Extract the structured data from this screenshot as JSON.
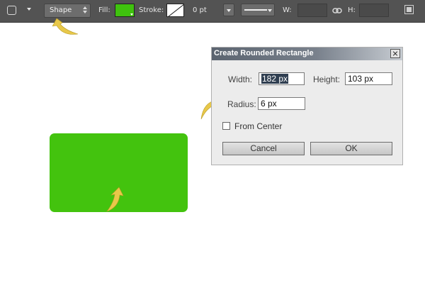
{
  "toolbar": {
    "mode_value": "Shape",
    "fill_label": "Fill:",
    "fill_color": "#3fc20e",
    "stroke_label": "Stroke:",
    "stroke_width": "0 pt",
    "w_label": "W:",
    "h_label": "H:"
  },
  "canvas": {
    "shape_color": "#43c30e",
    "callout_color": "#e8c84a"
  },
  "dialog": {
    "title": "Create Rounded Rectangle",
    "width_label": "Width:",
    "width_value": "182 px",
    "height_label": "Height:",
    "height_value": "103 px",
    "radius_label": "Radius:",
    "radius_value": "6 px",
    "from_center_label": "From Center",
    "from_center_checked": false,
    "cancel_label": "Cancel",
    "ok_label": "OK"
  }
}
